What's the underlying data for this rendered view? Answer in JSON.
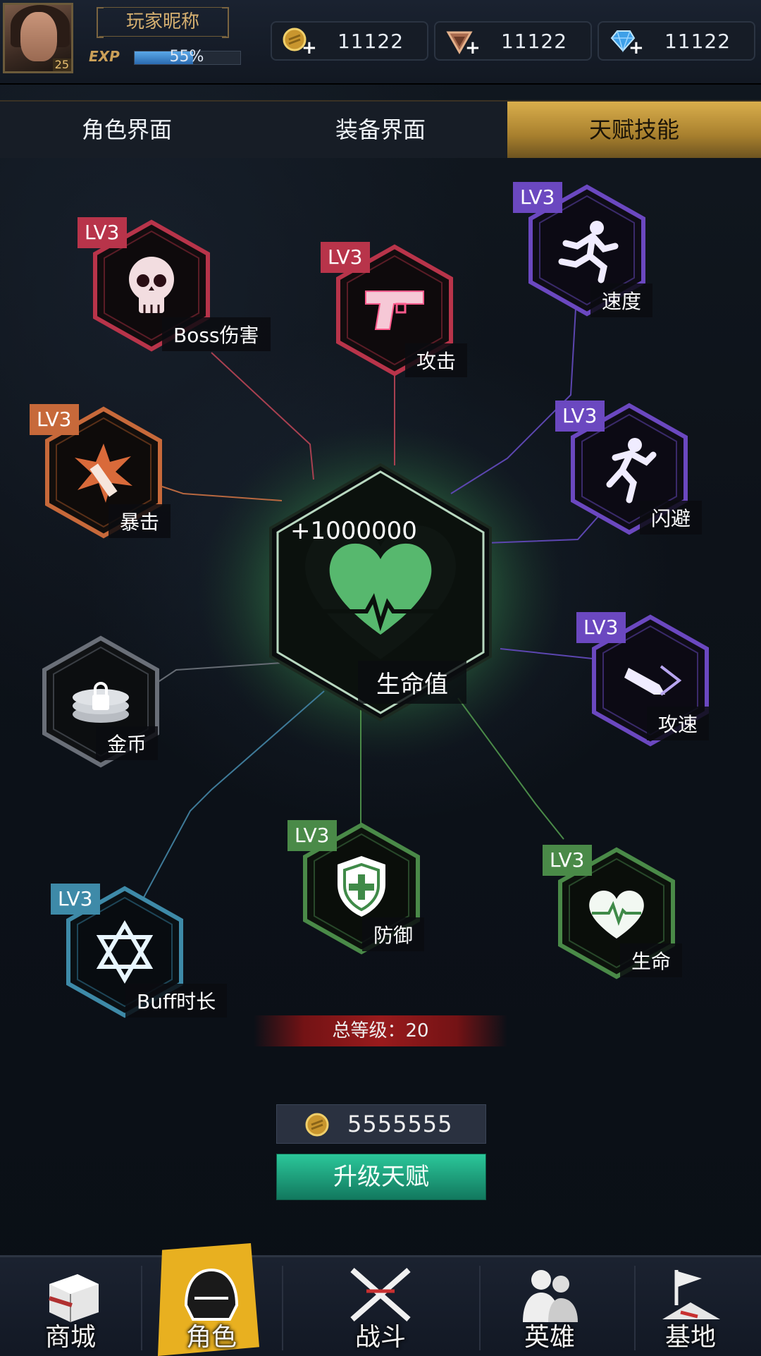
{
  "player": {
    "nickname": "玩家昵称",
    "level": "25",
    "exp_label": "EXP",
    "exp_percent_text": "55%",
    "exp_fraction": 0.55
  },
  "resources": [
    {
      "icon": "gold-coin-icon",
      "value": "11122"
    },
    {
      "icon": "bronze-medal-icon",
      "value": "11122"
    },
    {
      "icon": "blue-diamond-icon",
      "value": "11122"
    }
  ],
  "tabs": [
    {
      "label": "角色界面",
      "active": false
    },
    {
      "label": "装备界面",
      "active": false
    },
    {
      "label": "天赋技能",
      "active": true
    }
  ],
  "center_node": {
    "bonus": "+1000000",
    "label": "生命值",
    "icon": "heart-pulse-icon"
  },
  "talents": {
    "boss": {
      "badge": "LV3",
      "label": "Boss伤害",
      "icon": "skull-icon",
      "color": "#b8344a"
    },
    "attack": {
      "badge": "LV3",
      "label": "攻击",
      "icon": "pistol-icon",
      "color": "#b8344a"
    },
    "speed": {
      "badge": "LV3",
      "label": "速度",
      "icon": "running-man-icon",
      "color": "#6b48c0"
    },
    "crit": {
      "badge": "LV3",
      "label": "暴击",
      "icon": "crit-blast-icon",
      "color": "#c7693a"
    },
    "dodge": {
      "badge": "LV3",
      "label": "闪避",
      "icon": "dodge-runner-icon",
      "color": "#6b48c0"
    },
    "gold": {
      "badge": "",
      "label": "金币",
      "icon": "locked-coins-icon",
      "color": "#6a6f78"
    },
    "atkspeed": {
      "badge": "LV3",
      "label": "攻速",
      "icon": "bullet-icon",
      "color": "#6b48c0"
    },
    "defense": {
      "badge": "LV3",
      "label": "防御",
      "icon": "shield-plus-icon",
      "color": "#4a8a48"
    },
    "life": {
      "badge": "LV3",
      "label": "生命",
      "icon": "heart-icon",
      "color": "#4a8a48"
    },
    "buff": {
      "badge": "LV3",
      "label": "Buff时长",
      "icon": "hexagram-star-icon",
      "color": "#3e8aa8"
    }
  },
  "total_level": "总等级：20",
  "upgrade_cost": "5555555",
  "upgrade_label": "升级天赋",
  "nav": [
    {
      "label": "商城",
      "icon": "shop-crate-icon",
      "active": false
    },
    {
      "label": "角色",
      "icon": "helmet-icon",
      "active": true
    },
    {
      "label": "战斗",
      "icon": "crossed-rifles-icon",
      "active": false
    },
    {
      "label": "英雄",
      "icon": "heroes-icon",
      "active": false
    },
    {
      "label": "基地",
      "icon": "base-flag-icon",
      "active": false
    }
  ],
  "colors": {
    "accent_gold": "#d9ae4c",
    "upgrade_green": "#2bc79a",
    "red": "#b8344a",
    "purple": "#6b48c0",
    "orange": "#c7693a",
    "green": "#4a8a48",
    "blue": "#3e8aa8"
  }
}
